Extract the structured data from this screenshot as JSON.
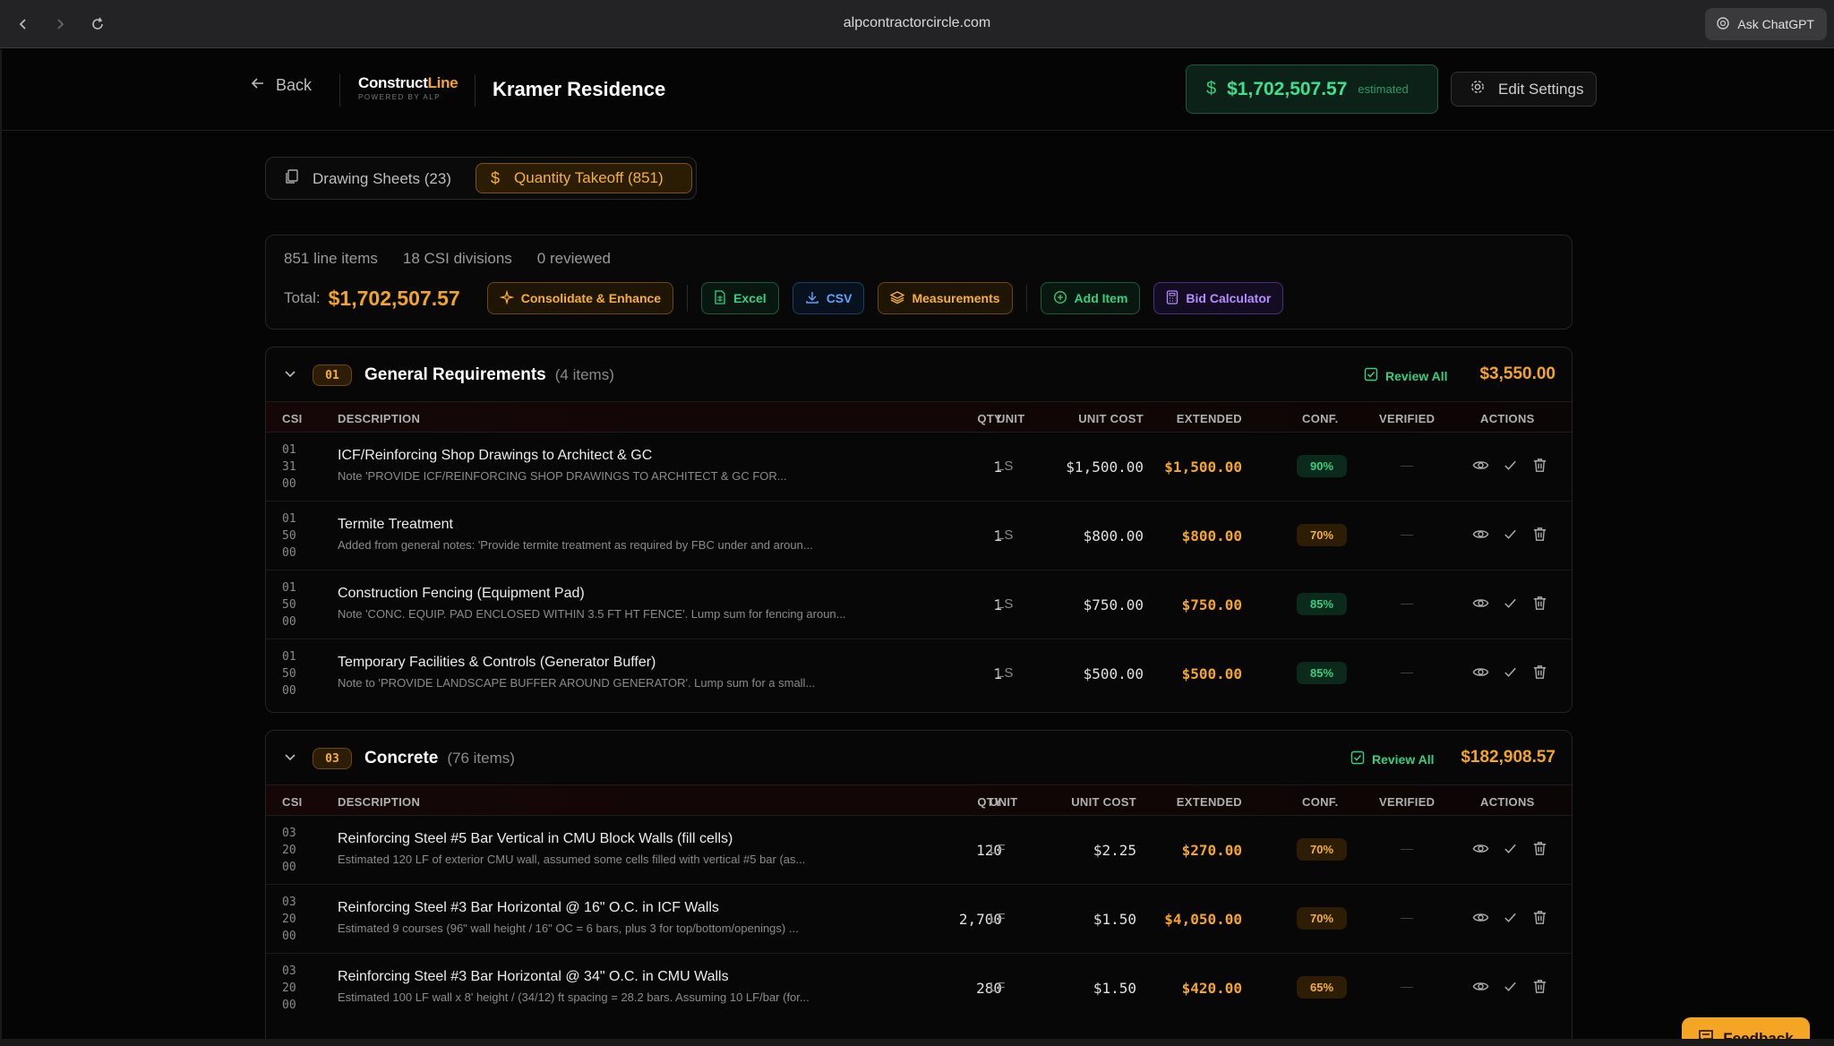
{
  "browser": {
    "url": "alpcontractorcircle.com",
    "ask_label": "Ask ChatGPT"
  },
  "header": {
    "back_label": "Back",
    "logo_main": "Construct",
    "logo_accent": "Line",
    "logo_sub": "POWERED BY ALP",
    "project_title": "Kramer Residence",
    "estimate_amount": "$1,702,507.57",
    "estimate_label": "estimated",
    "edit_settings_label": "Edit Settings"
  },
  "tabs": [
    {
      "label": "Drawing Sheets (23)"
    },
    {
      "label": "Quantity Takeoff (851)"
    }
  ],
  "summary": {
    "line_items": "851 line items",
    "divisions": "18 CSI divisions",
    "reviewed": "0 reviewed",
    "total_label": "Total:",
    "total_amount": "$1,702,507.57",
    "actions": [
      {
        "label": "Consolidate & Enhance"
      },
      {
        "label": "Excel"
      },
      {
        "label": "CSV"
      },
      {
        "label": "Measurements"
      },
      {
        "label": "Add Item"
      },
      {
        "label": "Bid Calculator"
      }
    ]
  },
  "columns": {
    "csi": "CSI",
    "description": "DESCRIPTION",
    "qty": "QTY",
    "unit": "UNIT",
    "unit_cost": "UNIT COST",
    "extended": "EXTENDED",
    "conf": "CONF.",
    "verified": "VERIFIED",
    "actions": "ACTIONS"
  },
  "sections": [
    {
      "code": "01",
      "name": "General Requirements",
      "count": "(4 items)",
      "review_all": "Review All",
      "total": "$3,550.00",
      "rows": [
        {
          "csi": [
            "01",
            "31",
            "00"
          ],
          "title": "ICF/Reinforcing Shop Drawings to Architect & GC",
          "note": "Note 'PROVIDE ICF/REINFORCING SHOP DRAWINGS TO ARCHITECT & GC FOR...",
          "qty": "1",
          "unit": "LS",
          "unit_cost": "$1,500.00",
          "extended": "$1,500.00",
          "conf": "90%",
          "conf_color": "green",
          "verified": "—"
        },
        {
          "csi": [
            "01",
            "50",
            "00"
          ],
          "title": "Termite Treatment",
          "note": "Added from general notes: 'Provide termite treatment as required by FBC under and aroun...",
          "qty": "1",
          "unit": "LS",
          "unit_cost": "$800.00",
          "extended": "$800.00",
          "conf": "70%",
          "conf_color": "orange",
          "verified": "—"
        },
        {
          "csi": [
            "01",
            "50",
            "00"
          ],
          "title": "Construction Fencing (Equipment Pad)",
          "note": "Note 'CONC. EQUIP. PAD ENCLOSED WITHIN 3.5 FT HT FENCE'. Lump sum for fencing aroun...",
          "qty": "1",
          "unit": "LS",
          "unit_cost": "$750.00",
          "extended": "$750.00",
          "conf": "85%",
          "conf_color": "green",
          "verified": "—"
        },
        {
          "csi": [
            "01",
            "50",
            "00"
          ],
          "title": "Temporary Facilities & Controls (Generator Buffer)",
          "note": "Note to 'PROVIDE LANDSCAPE BUFFER AROUND GENERATOR'. Lump sum for a small...",
          "qty": "1",
          "unit": "LS",
          "unit_cost": "$500.00",
          "extended": "$500.00",
          "conf": "85%",
          "conf_color": "green",
          "verified": "—"
        }
      ]
    },
    {
      "code": "03",
      "name": "Concrete",
      "count": "(76 items)",
      "review_all": "Review All",
      "total": "$182,908.57",
      "rows": [
        {
          "csi": [
            "03",
            "20",
            "00"
          ],
          "title": "Reinforcing Steel #5 Bar Vertical in CMU Block Walls (fill cells)",
          "note": "Estimated 120 LF of exterior CMU wall, assumed some cells filled with vertical #5 bar (as...",
          "qty": "120",
          "unit": "LF",
          "unit_cost": "$2.25",
          "extended": "$270.00",
          "conf": "70%",
          "conf_color": "orange",
          "verified": "—"
        },
        {
          "csi": [
            "03",
            "20",
            "00"
          ],
          "title": "Reinforcing Steel #3 Bar Horizontal @ 16\" O.C. in ICF Walls",
          "note": "Estimated 9 courses (96\" wall height / 16\" OC = 6 bars, plus 3 for top/bottom/openings) ...",
          "qty": "2,700",
          "unit": "LF",
          "unit_cost": "$1.50",
          "extended": "$4,050.00",
          "conf": "70%",
          "conf_color": "orange",
          "verified": "—"
        },
        {
          "csi": [
            "03",
            "20",
            "00"
          ],
          "title": "Reinforcing Steel #3 Bar Horizontal @ 34\" O.C. in CMU Walls",
          "note": "Estimated 100 LF wall x 8' height / (34/12) ft spacing = 28.2 bars. Assuming 10 LF/bar (for...",
          "qty": "280",
          "unit": "LF",
          "unit_cost": "$1.50",
          "extended": "$420.00",
          "conf": "65%",
          "conf_color": "orange",
          "verified": "—"
        }
      ]
    }
  ],
  "feedback_label": "Feedback"
}
